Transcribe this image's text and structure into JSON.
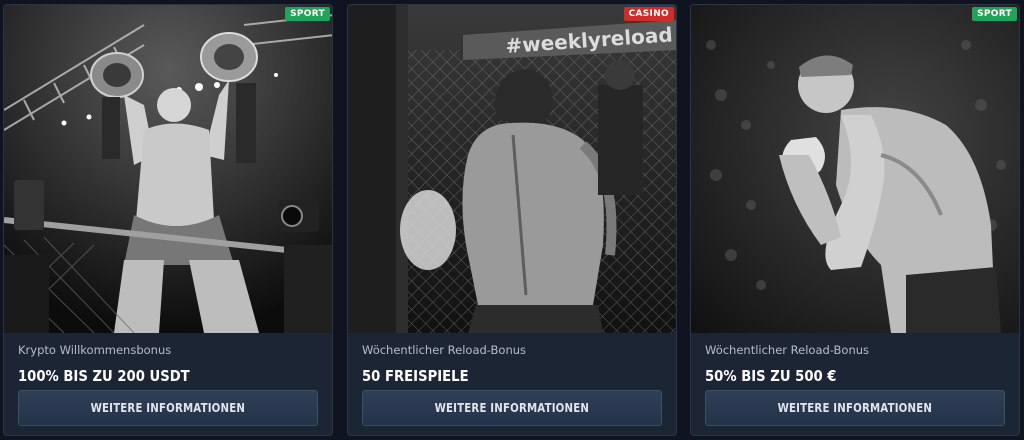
{
  "cards": [
    {
      "badge": "SPORT",
      "badge_color": "#22a35a",
      "subtitle": "Krypto Willkommensbonus",
      "title": "100% BIS ZU 200 USDT",
      "button_label": "WEITERE INFORMATIONEN",
      "image_icon": "fighter-with-belts-image"
    },
    {
      "badge": "CASINO",
      "badge_color": "#d12b2b",
      "subtitle": "Wöchentlicher Reload-Bonus",
      "title": "50 FREISPIELE",
      "button_label": "WEITERE INFORMATIONEN",
      "image_icon": "fighter-in-cage-image",
      "image_text": "#weeklyreload"
    },
    {
      "badge": "SPORT",
      "badge_color": "#22a35a",
      "subtitle": "Wöchentlicher Reload-Bonus",
      "title": "50% BIS ZU 500 €",
      "button_label": "WEITERE INFORMATIONEN",
      "image_icon": "fighter-guard-stance-image"
    }
  ]
}
